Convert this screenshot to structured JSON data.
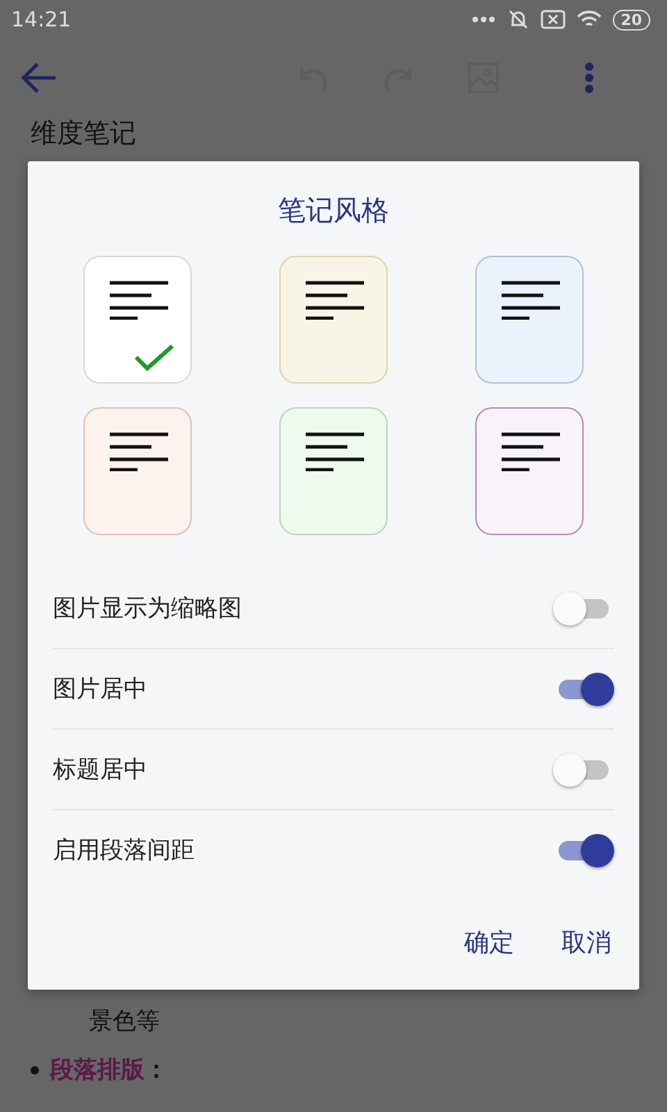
{
  "status_bar": {
    "time": "14:21",
    "battery": "20"
  },
  "note": {
    "title": "维度笔记",
    "paragraph_end": "景色等",
    "bullet": {
      "label": "段落排版",
      "suffix": "："
    }
  },
  "dialog": {
    "title": "笔记风格",
    "styles": [
      {
        "color": "#ffffff",
        "selected": true
      },
      {
        "color": "#f7f6e6",
        "selected": false
      },
      {
        "color": "#eaf3fb",
        "selected": false
      },
      {
        "color": "#fdf3ee",
        "selected": false
      },
      {
        "color": "#eefaee",
        "selected": false
      },
      {
        "color": "#f8f2fa",
        "selected": false
      }
    ],
    "options": [
      {
        "label": "图片显示为缩略图",
        "on": false
      },
      {
        "label": "图片居中",
        "on": true
      },
      {
        "label": "标题居中",
        "on": false
      },
      {
        "label": "启用段落间距",
        "on": true
      }
    ],
    "buttons": [
      "确定",
      "取消"
    ]
  }
}
